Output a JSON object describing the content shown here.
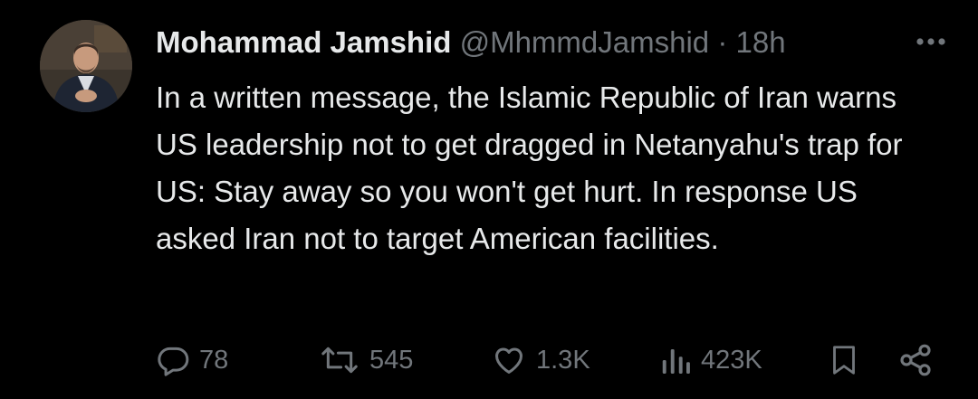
{
  "tweet": {
    "display_name": "Mohammad Jamshid",
    "handle": "@MhmmdJamshid",
    "separator": "·",
    "time": "18h",
    "text": "In a written message, the Islamic Republic of Iran warns US leadership not to get dragged in Netanyahu's trap for US: Stay away so you won't get hurt. In response US asked Iran not to target American facilities."
  },
  "actions": {
    "replies": "78",
    "reposts": "545",
    "likes": "1.3K",
    "views": "423K"
  },
  "icons": {
    "reply": "reply-icon",
    "repost": "repost-icon",
    "like": "heart-icon",
    "views": "views-icon",
    "bookmark": "bookmark-icon",
    "share": "share-icon",
    "more": "more-icon"
  },
  "colors": {
    "background": "#000000",
    "text": "#e7e9ea",
    "muted": "#71767b"
  }
}
